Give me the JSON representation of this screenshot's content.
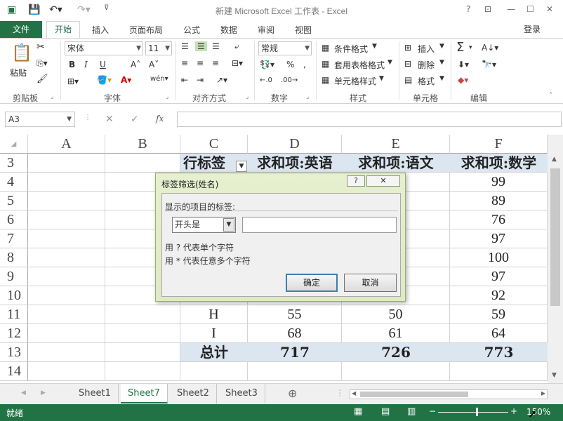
{
  "window": {
    "title": "新建 Microsoft Excel 工作表 - Excel",
    "help_icon": "?",
    "minimize_icon": "—",
    "maximize_icon": "☐",
    "close_icon": "✕"
  },
  "tabs": {
    "file": "文件",
    "home": "开始",
    "insert": "插入",
    "layout": "页面布局",
    "formulas": "公式",
    "data": "数据",
    "review": "审阅",
    "view": "视图",
    "login": "登录"
  },
  "ribbon": {
    "paste": "粘贴",
    "font_name": "宋体",
    "font_size": "11",
    "bold": "B",
    "italic": "I",
    "underline": "U",
    "number_format": "常规",
    "percent": "%",
    "conditional_format": "条件格式",
    "table_format": "套用表格格式",
    "cell_style": "单元格样式",
    "insert": "插入",
    "delete": "删除",
    "format": "格式",
    "groups": {
      "clipboard": "剪贴板",
      "font": "字体",
      "alignment": "对齐方式",
      "number": "数字",
      "styles": "样式",
      "cells": "单元格",
      "editing": "编辑"
    }
  },
  "formula_bar": {
    "name_box": "A3",
    "fx": "fx",
    "value": ""
  },
  "columns": [
    "A",
    "B",
    "C",
    "D",
    "E",
    "F"
  ],
  "rows": [
    "3",
    "4",
    "5",
    "6",
    "7",
    "8",
    "9",
    "10",
    "11",
    "12",
    "13",
    "14"
  ],
  "pivot": {
    "header": [
      "行标签",
      "求和项:英语",
      "求和项:语文",
      "求和项:数学"
    ],
    "rows": [
      {
        "label": "",
        "d": "",
        "e": "",
        "f": "99"
      },
      {
        "label": "",
        "d": "",
        "e": "",
        "f": "89"
      },
      {
        "label": "",
        "d": "",
        "e": "",
        "f": "76"
      },
      {
        "label": "",
        "d": "",
        "e": "",
        "f": "97"
      },
      {
        "label": "",
        "d": "",
        "e": "",
        "f": "100"
      },
      {
        "label": "",
        "d": "",
        "e": "",
        "f": "97"
      },
      {
        "label": "",
        "d": "",
        "e": "",
        "f": "92"
      },
      {
        "label": "H",
        "d": "55",
        "e": "50",
        "f": "59"
      },
      {
        "label": "I",
        "d": "68",
        "e": "61",
        "f": "64"
      }
    ],
    "total": {
      "label": "总计",
      "d": "717",
      "e": "726",
      "f": "773"
    }
  },
  "dialog": {
    "title": "标签筛选(姓名)",
    "help": "?",
    "close": "✕",
    "group_label": "显示的项目的标签:",
    "operator": "开头是",
    "value": "",
    "hint1": "用 ? 代表单个字符",
    "hint2": "用 * 代表任意多个字符",
    "ok": "确定",
    "cancel": "取消"
  },
  "sheets": [
    "Sheet1",
    "Sheet7",
    "Sheet2",
    "Sheet3"
  ],
  "active_sheet": "Sheet7",
  "status": {
    "ready": "就绪",
    "zoom": "150%"
  }
}
